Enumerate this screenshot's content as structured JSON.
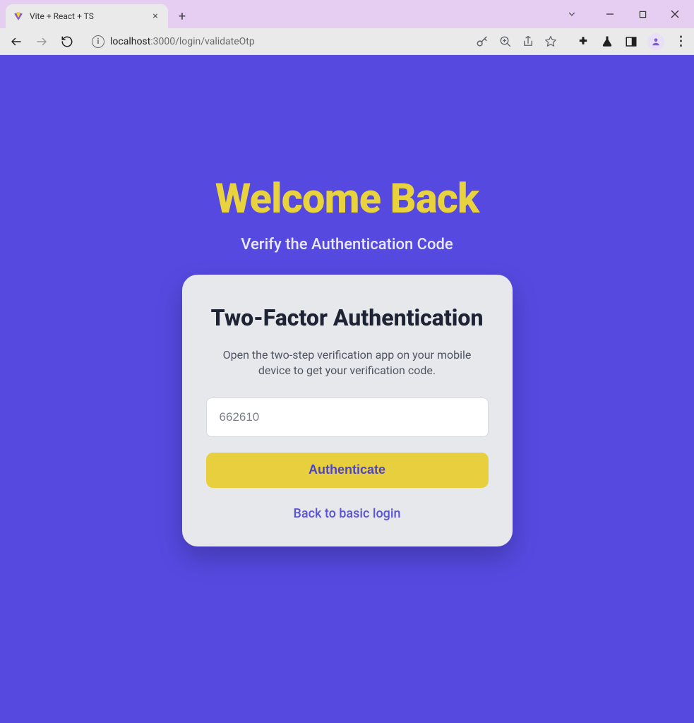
{
  "browser": {
    "tab_title": "Vite + React + TS",
    "url_host": "localhost",
    "url_port_path": ":3000/login/validateOtp"
  },
  "page": {
    "headline": "Welcome Back",
    "subhead": "Verify the Authentication Code"
  },
  "card": {
    "title": "Two-Factor Authentication",
    "description": "Open the two-step verification app on your mobile device to get your verification code.",
    "otp_value": "662610",
    "authenticate_label": "Authenticate",
    "back_link_label": "Back to basic login"
  }
}
